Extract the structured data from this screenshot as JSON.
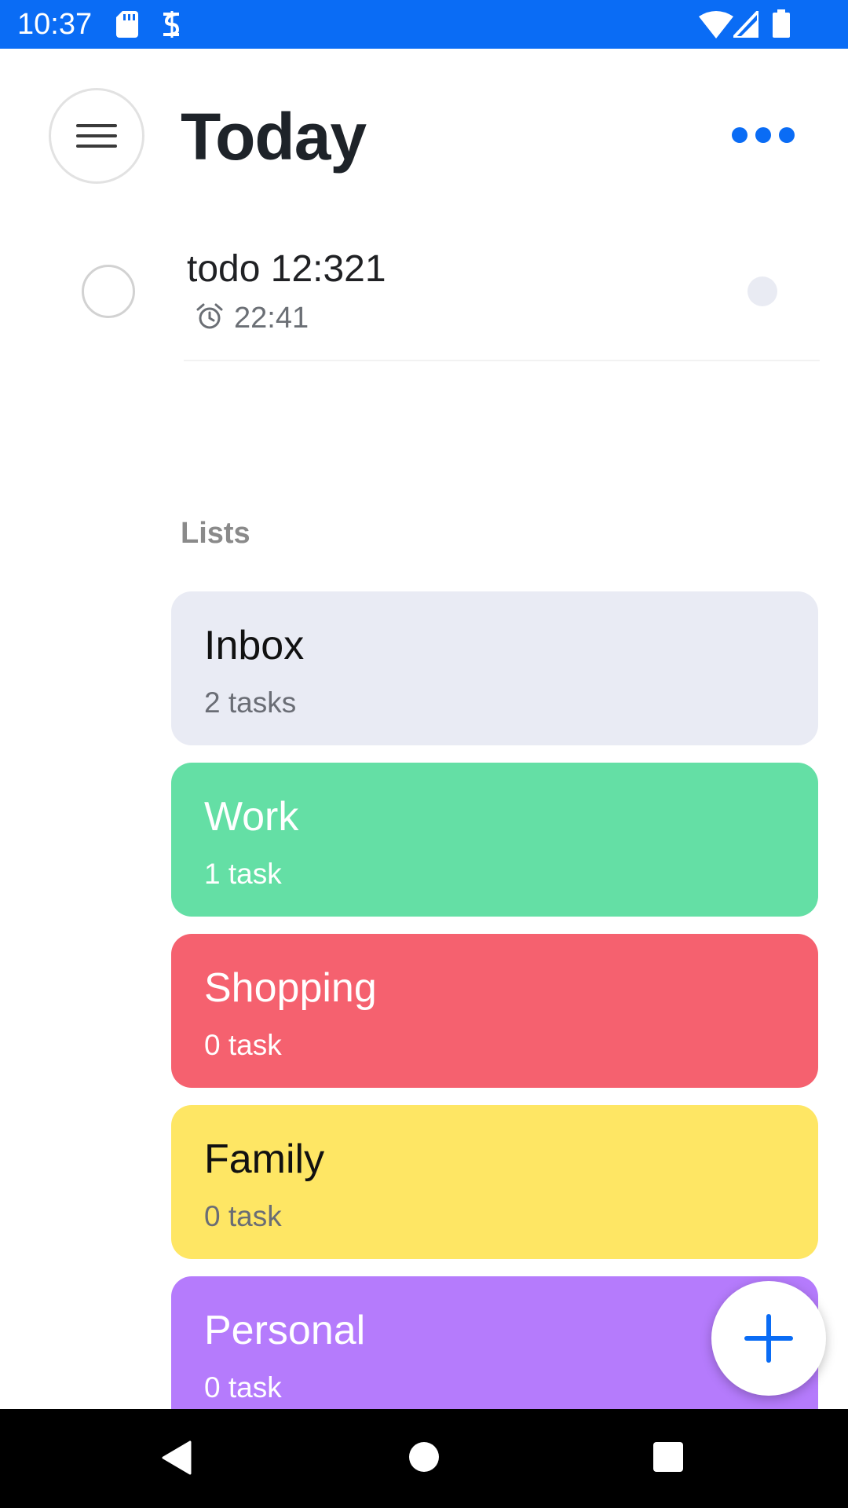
{
  "status_bar": {
    "time": "10:37",
    "background": "#0a6cf5",
    "icons_left": [
      "sd-card-icon",
      "data-saver-icon"
    ],
    "icons_right": [
      "wifi-icon",
      "cellular-signal-icon",
      "battery-icon"
    ]
  },
  "header": {
    "title": "Today",
    "menu_icon": "hamburger-menu-icon",
    "more_icon": "more-dots-icon",
    "accent_color": "#0a6cf5"
  },
  "tasks": [
    {
      "title": "todo 12:321",
      "time": "22:41",
      "completed": false,
      "reminder_icon": "alarm-clock-icon"
    }
  ],
  "lists_section": {
    "heading": "Lists",
    "items": [
      {
        "name": "Inbox",
        "count": "2 tasks",
        "color": "#e9ebf4",
        "text_color": "#111111",
        "sub_color": "#6a6d75"
      },
      {
        "name": "Work",
        "count": "1 task",
        "color": "#64dfa5",
        "text_color": "#ffffff",
        "sub_color": "#ffffff"
      },
      {
        "name": "Shopping",
        "count": "0 task",
        "color": "#f5616f",
        "text_color": "#ffffff",
        "sub_color": "#ffffff"
      },
      {
        "name": "Family",
        "count": "0 task",
        "color": "#fee664",
        "text_color": "#111111",
        "sub_color": "#6a6d75"
      },
      {
        "name": "Personal",
        "count": "0 task",
        "color": "#b57bfc",
        "text_color": "#ffffff",
        "sub_color": "#ffffff"
      }
    ]
  },
  "fab": {
    "icon": "plus-icon"
  },
  "nav_bar": {
    "back_icon": "back-triangle-icon",
    "home_icon": "home-circle-icon",
    "recents_icon": "recents-square-icon"
  }
}
